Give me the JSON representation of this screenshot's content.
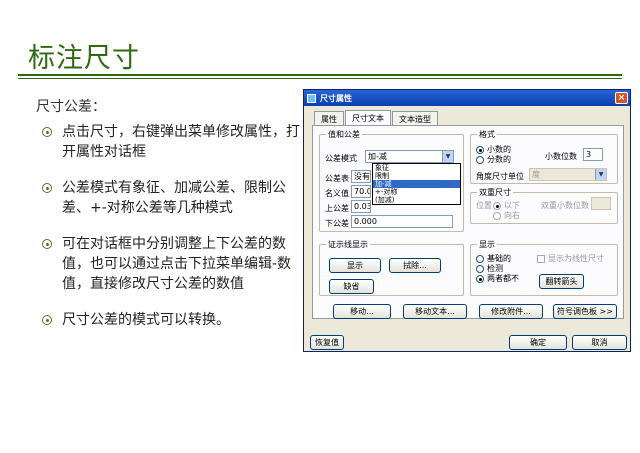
{
  "slide": {
    "title": "标注尺寸",
    "heading": "尺寸公差：",
    "bullets": [
      "点击尺寸，右键弹出菜单修改属性，打开属性对话框",
      "公差模式有象征、加减公差、限制公差、+-对称公差等几种模式",
      "可在对话框中分别调整上下公差的数值，也可以通过点击下拉菜单编辑-数值，直接修改尺寸公差的数值",
      "尺寸公差的模式可以转换。"
    ]
  },
  "dialog": {
    "title": "尺寸属性",
    "close": "×",
    "tabs": [
      "属性",
      "尺寸文本",
      "文本造型"
    ],
    "value_group": {
      "title": "值和公差",
      "mode_label": "公差模式",
      "mode_value": "加-减",
      "mode_options": [
        "象征",
        "限制",
        "加-减",
        "+-对称",
        "(加减)"
      ],
      "table_label": "公差表",
      "table_value": "没有",
      "nominal_label": "名义值",
      "nominal_value": "70.00",
      "upper_label": "上公差",
      "upper_value": "0.033",
      "lower_label": "下公差",
      "lower_value": "0.000"
    },
    "format_group": {
      "title": "格式",
      "radio_decimal": "小数的",
      "radio_fraction": "分数的",
      "decimals_label": "小数位数",
      "decimals_value": "3",
      "angle_unit_label": "角度尺寸单位",
      "angle_unit_value": "度"
    },
    "dual_group": {
      "title": "双重尺寸",
      "position_label": "位置",
      "radio_below": "以下",
      "radio_right": "向右",
      "dual_decimals_label": "双重小数位数"
    },
    "witness_group": {
      "title": "证示线显示",
      "show_button": "显示",
      "erase_button": "拭除...",
      "default_button": "缺省"
    },
    "display_group": {
      "title": "显示",
      "radio_basic": "基础的",
      "radio_inspect": "检测",
      "radio_neither": "两者都不",
      "linear_checkbox": "显示为线性尺寸",
      "flip_button": "翻转箭头"
    },
    "buttons": {
      "move": "移动...",
      "move_text": "移动文本...",
      "edit_attach": "修改附件...",
      "symbol_palette": "符号调色板 >>",
      "restore": "恢复值",
      "ok": "确定",
      "cancel": "取消"
    }
  }
}
